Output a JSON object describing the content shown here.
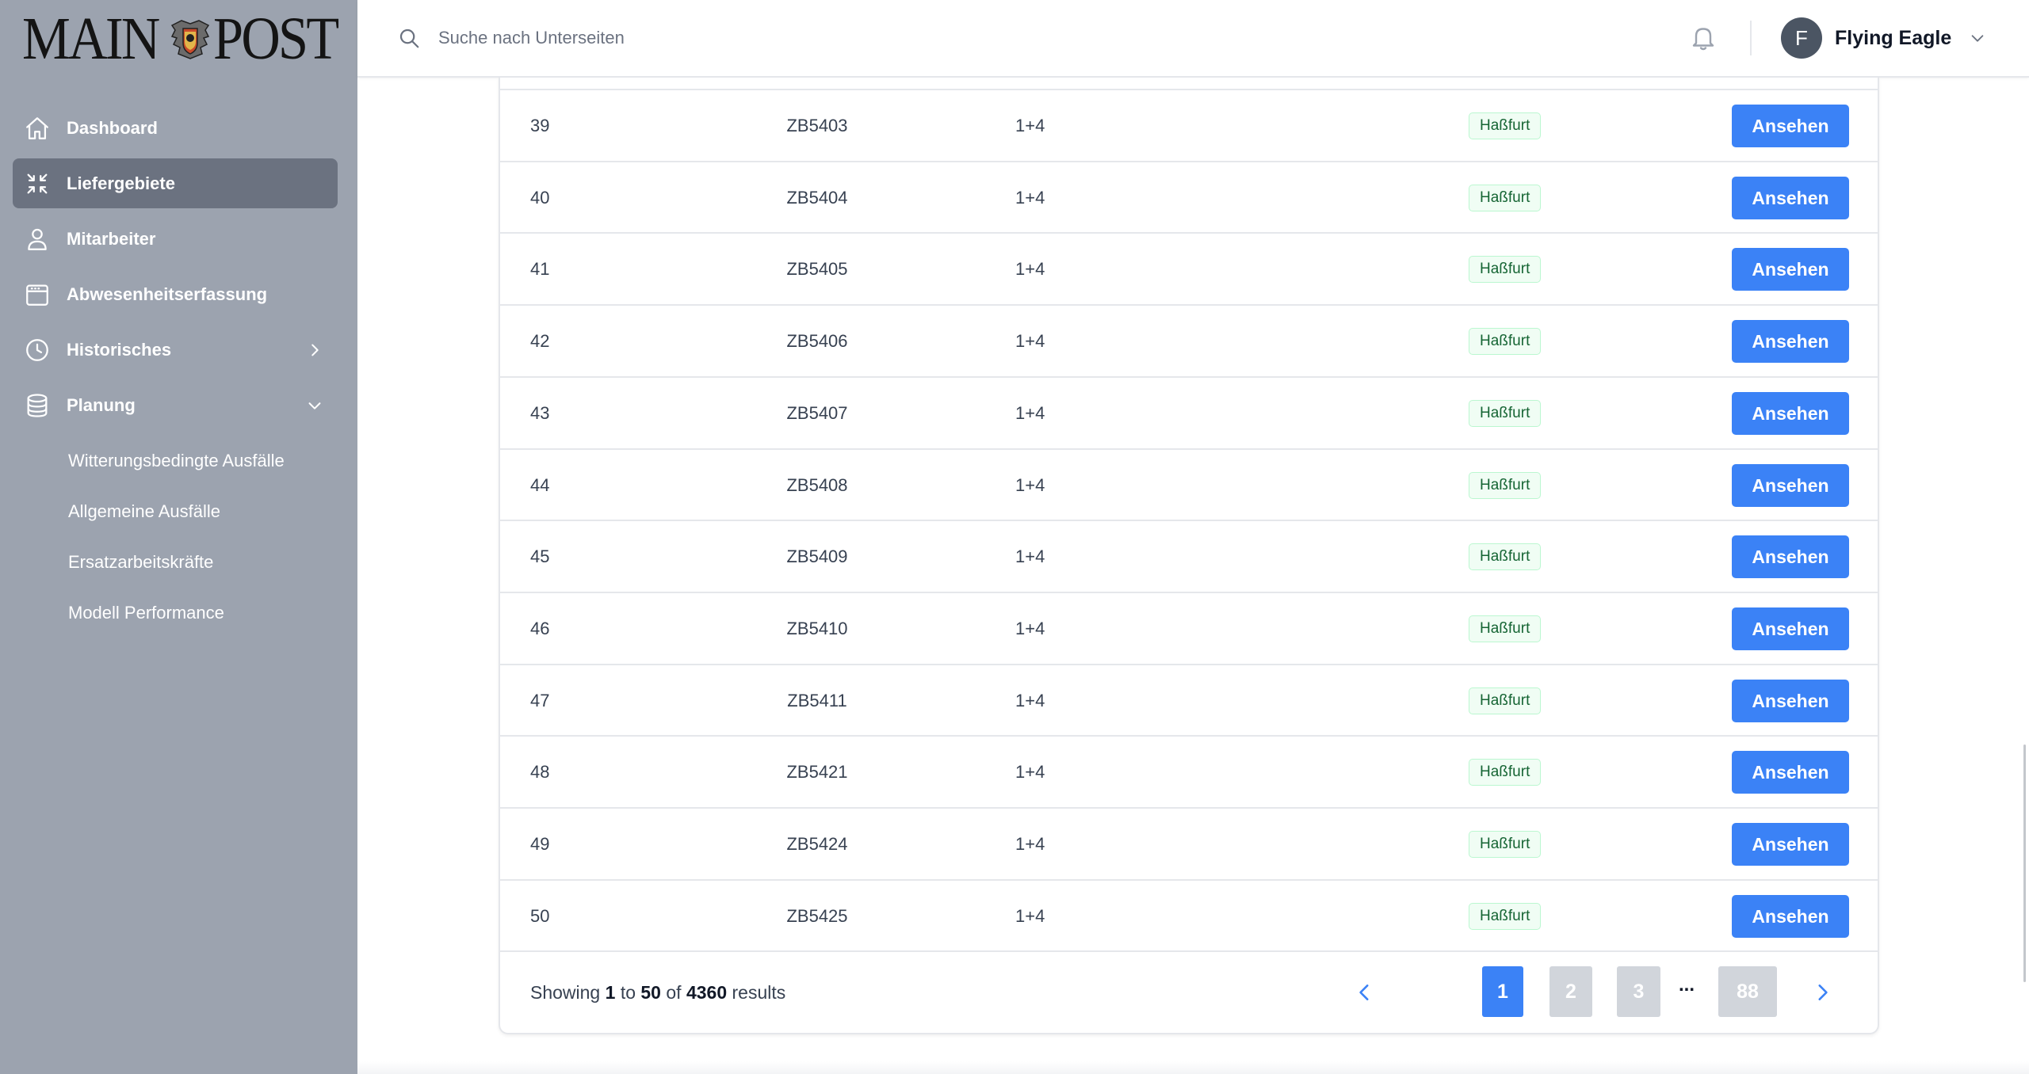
{
  "app": {
    "logo_text_left": "MAIN",
    "logo_text_right": "POST"
  },
  "sidebar": {
    "items": [
      {
        "label": "Dashboard",
        "icon": "home-icon"
      },
      {
        "label": "Liefergebiete",
        "icon": "arrows-collapse-icon",
        "active": true
      },
      {
        "label": "Mitarbeiter",
        "icon": "user-icon"
      },
      {
        "label": "Abwesenheitserfassung",
        "icon": "calendar-icon"
      },
      {
        "label": "Historisches",
        "icon": "clock-icon",
        "chevron": "chevron-right-icon"
      },
      {
        "label": "Planung",
        "icon": "database-icon",
        "chevron": "chevron-down-icon"
      }
    ],
    "sub_items": [
      {
        "label": "Witterungsbedingte Ausfälle"
      },
      {
        "label": "Allgemeine Ausfälle"
      },
      {
        "label": "Ersatzarbeitskräfte"
      },
      {
        "label": "Modell Performance"
      }
    ]
  },
  "header": {
    "search_placeholder": "Suche nach Unterseiten",
    "user_initial": "F",
    "user_name": "Flying Eagle"
  },
  "table": {
    "rows": [
      {
        "num": "39",
        "code": "ZB5403",
        "type": "1+4",
        "location": "Haßfurt",
        "action": "Ansehen"
      },
      {
        "num": "40",
        "code": "ZB5404",
        "type": "1+4",
        "location": "Haßfurt",
        "action": "Ansehen"
      },
      {
        "num": "41",
        "code": "ZB5405",
        "type": "1+4",
        "location": "Haßfurt",
        "action": "Ansehen"
      },
      {
        "num": "42",
        "code": "ZB5406",
        "type": "1+4",
        "location": "Haßfurt",
        "action": "Ansehen"
      },
      {
        "num": "43",
        "code": "ZB5407",
        "type": "1+4",
        "location": "Haßfurt",
        "action": "Ansehen"
      },
      {
        "num": "44",
        "code": "ZB5408",
        "type": "1+4",
        "location": "Haßfurt",
        "action": "Ansehen"
      },
      {
        "num": "45",
        "code": "ZB5409",
        "type": "1+4",
        "location": "Haßfurt",
        "action": "Ansehen"
      },
      {
        "num": "46",
        "code": "ZB5410",
        "type": "1+4",
        "location": "Haßfurt",
        "action": "Ansehen"
      },
      {
        "num": "47",
        "code": "ZB5411",
        "type": "1+4",
        "location": "Haßfurt",
        "action": "Ansehen"
      },
      {
        "num": "48",
        "code": "ZB5421",
        "type": "1+4",
        "location": "Haßfurt",
        "action": "Ansehen"
      },
      {
        "num": "49",
        "code": "ZB5424",
        "type": "1+4",
        "location": "Haßfurt",
        "action": "Ansehen"
      },
      {
        "num": "50",
        "code": "ZB5425",
        "type": "1+4",
        "location": "Haßfurt",
        "action": "Ansehen"
      }
    ]
  },
  "pagination": {
    "showing_prefix": "Showing",
    "from": "1",
    "to_word": "to",
    "to": "50",
    "of_word": "of",
    "total": "4360",
    "results_word": "results",
    "pages": [
      "1",
      "2",
      "3",
      "88"
    ],
    "current_page": "1",
    "ellipsis": "..."
  },
  "colors": {
    "primary": "#3b82f6",
    "sidebar_bg": "#9ca3af",
    "sidebar_active": "#6b7280",
    "badge_text": "#166534",
    "badge_bg": "#f0fdf4"
  }
}
